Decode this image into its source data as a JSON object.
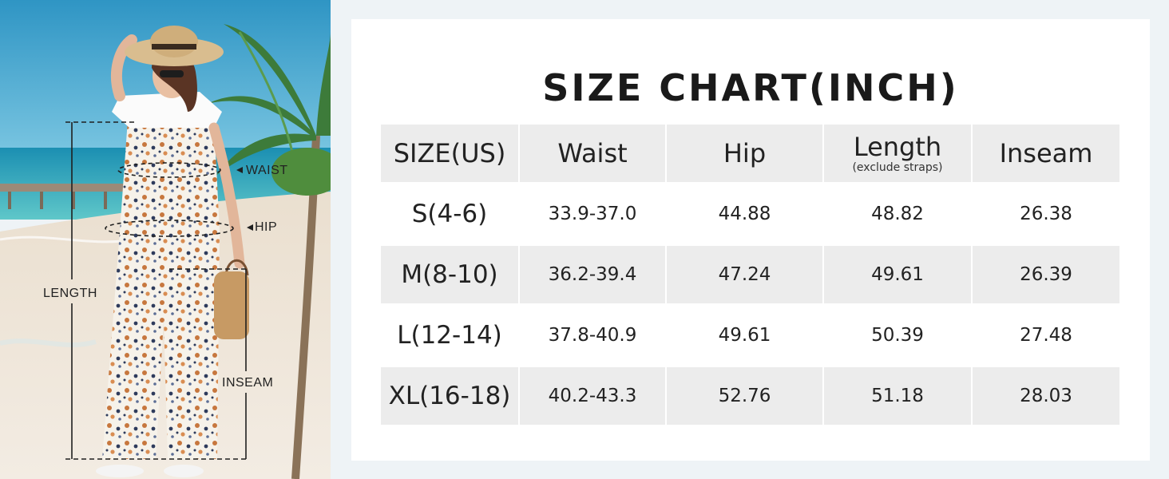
{
  "photo": {
    "labels": {
      "waist": "WAIST",
      "hip": "HIP",
      "length": "LENGTH",
      "inseam": "INSEAM"
    }
  },
  "chart": {
    "title": "SIZE CHART(INCH)",
    "headers": [
      "SIZE(US)",
      "Waist",
      "Hip",
      "Length",
      "Inseam"
    ],
    "length_note": "(exclude straps)",
    "rows": [
      {
        "size": "S(4-6)",
        "waist": "33.9-37.0",
        "hip": "44.88",
        "length": "48.82",
        "inseam": "26.38"
      },
      {
        "size": "M(8-10)",
        "waist": "36.2-39.4",
        "hip": "47.24",
        "length": "49.61",
        "inseam": "26.39"
      },
      {
        "size": "L(12-14)",
        "waist": "37.8-40.9",
        "hip": "49.61",
        "length": "50.39",
        "inseam": "27.48"
      },
      {
        "size": "XL(16-18)",
        "waist": "40.2-43.3",
        "hip": "52.76",
        "length": "51.18",
        "inseam": "28.03"
      }
    ]
  },
  "colors": {
    "background": "#eef3f6",
    "card": "#ffffff",
    "row_gray": "#ececec",
    "text": "#222222"
  }
}
